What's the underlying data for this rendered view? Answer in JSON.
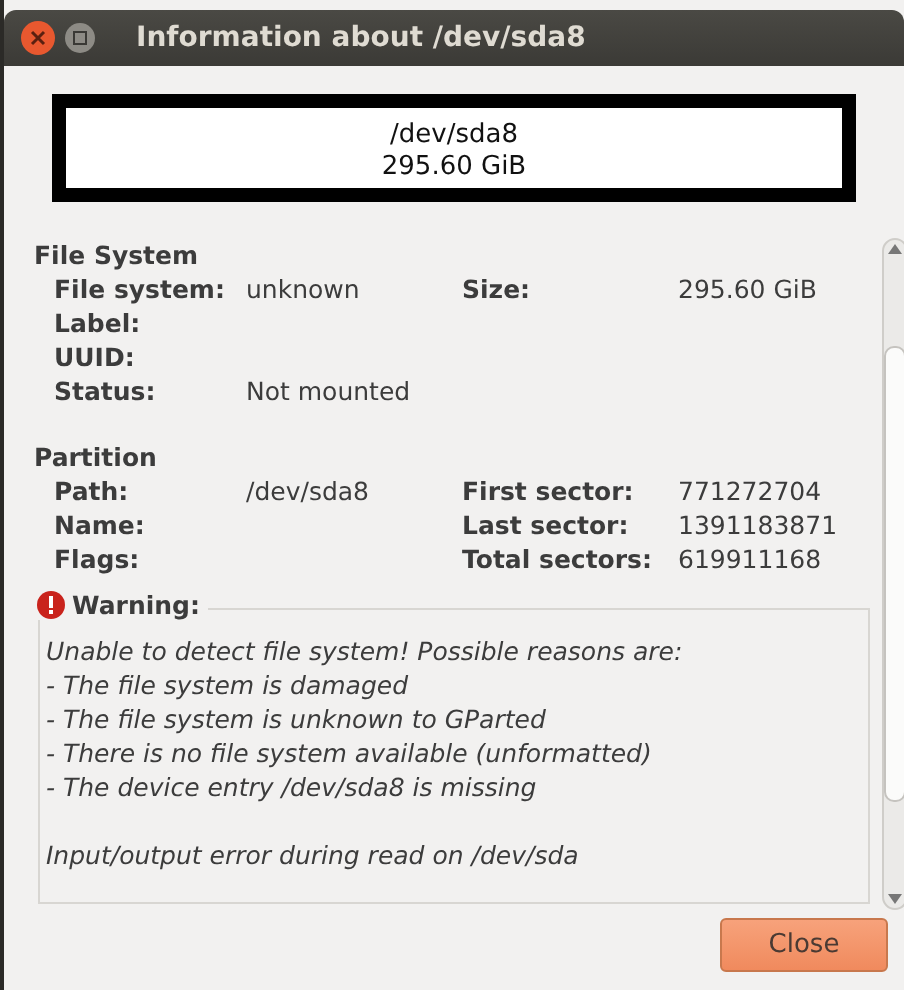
{
  "window": {
    "title": "Information about /dev/sda8"
  },
  "summary": {
    "path": "/dev/sda8",
    "size": "295.60 GiB"
  },
  "file_system": {
    "heading": "File System",
    "fields": [
      {
        "label": "File system:",
        "value": "unknown",
        "label2": "Size:",
        "value2": "295.60 GiB"
      },
      {
        "label": "Label:"
      },
      {
        "label": "UUID:"
      },
      {
        "label": "Status:",
        "value": "Not mounted"
      }
    ]
  },
  "partition": {
    "heading": "Partition",
    "fields": [
      {
        "label": "Path:",
        "value": "/dev/sda8",
        "label2": "First sector:",
        "value2": "771272704"
      },
      {
        "label": "Name:",
        "label2": "Last sector:",
        "value2": "1391183871"
      },
      {
        "label": "Flags:",
        "label2": "Total sectors:",
        "value2": "619911168"
      }
    ]
  },
  "warning": {
    "heading": "Warning:",
    "lines": [
      "Unable to detect file system! Possible reasons are:",
      "- The file system is damaged",
      "- The file system is unknown to GParted",
      "- There is no file system available (unformatted)",
      "- The device entry /dev/sda8 is missing"
    ],
    "error": "Input/output error during read on /dev/sda"
  },
  "buttons": [
    "Close"
  ]
}
